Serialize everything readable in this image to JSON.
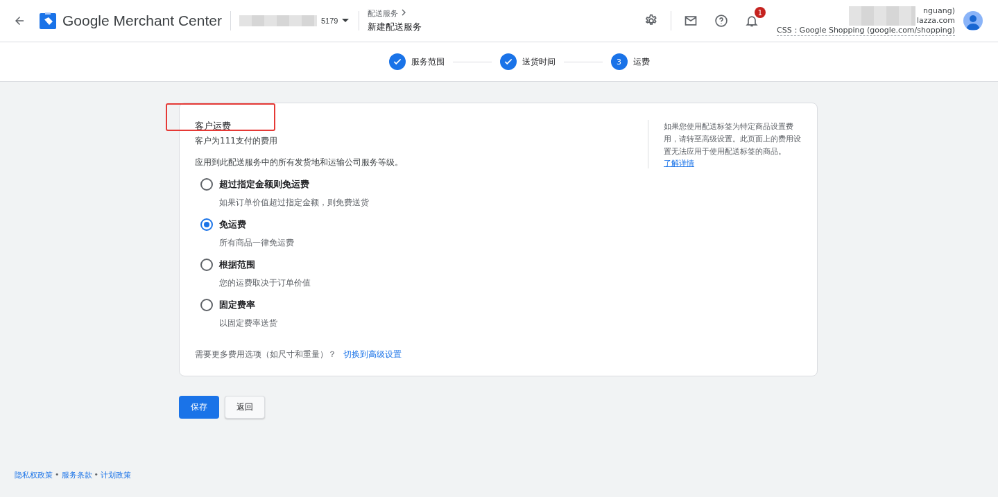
{
  "header": {
    "product_name": "Google Merchant Center",
    "account": {
      "visible_text": "5179"
    },
    "breadcrumb": {
      "parent": "配送服务",
      "title": "新建配送服务"
    },
    "notifications_count": "1",
    "user": {
      "line_1": "nguang)",
      "line_2": "lazza.com",
      "css_line": "CSS：Google Shopping (google.com/shopping)"
    }
  },
  "stepper": [
    {
      "label": "服务范围",
      "completed": true
    },
    {
      "label": "送货时间",
      "completed": true
    },
    {
      "label": "运费",
      "completed": false,
      "number": "3"
    }
  ],
  "card": {
    "title": "客户运费",
    "subtitle": "客户为111支付的费用",
    "description": "应用到此配送服务中的所有发货地和运输公司服务等级。",
    "options": [
      {
        "label": "超过指定金额则免运费",
        "hint": "如果订单价值超过指定金额，则免费送货",
        "selected": false
      },
      {
        "label": "免运费",
        "hint": "所有商品一律免运费",
        "selected": true
      },
      {
        "label": "根据范围",
        "hint": "您的运费取决于订单价值",
        "selected": false
      },
      {
        "label": "固定费率",
        "hint": "以固定费率送货",
        "selected": false
      }
    ],
    "more_text": "需要更多费用选项（如尺寸和重量）？",
    "more_link": "切换到高级设置",
    "aside": {
      "text": "如果您使用配送标签为特定商品设置费用，请转至高级设置。此页面上的费用设置无法应用于使用配送标签的商品。",
      "link": "了解详情"
    }
  },
  "buttons": {
    "save": "保存",
    "back": "返回"
  },
  "footer": [
    "隐私权政策",
    "服务条款",
    "计划政策"
  ],
  "footer_separator": "•"
}
